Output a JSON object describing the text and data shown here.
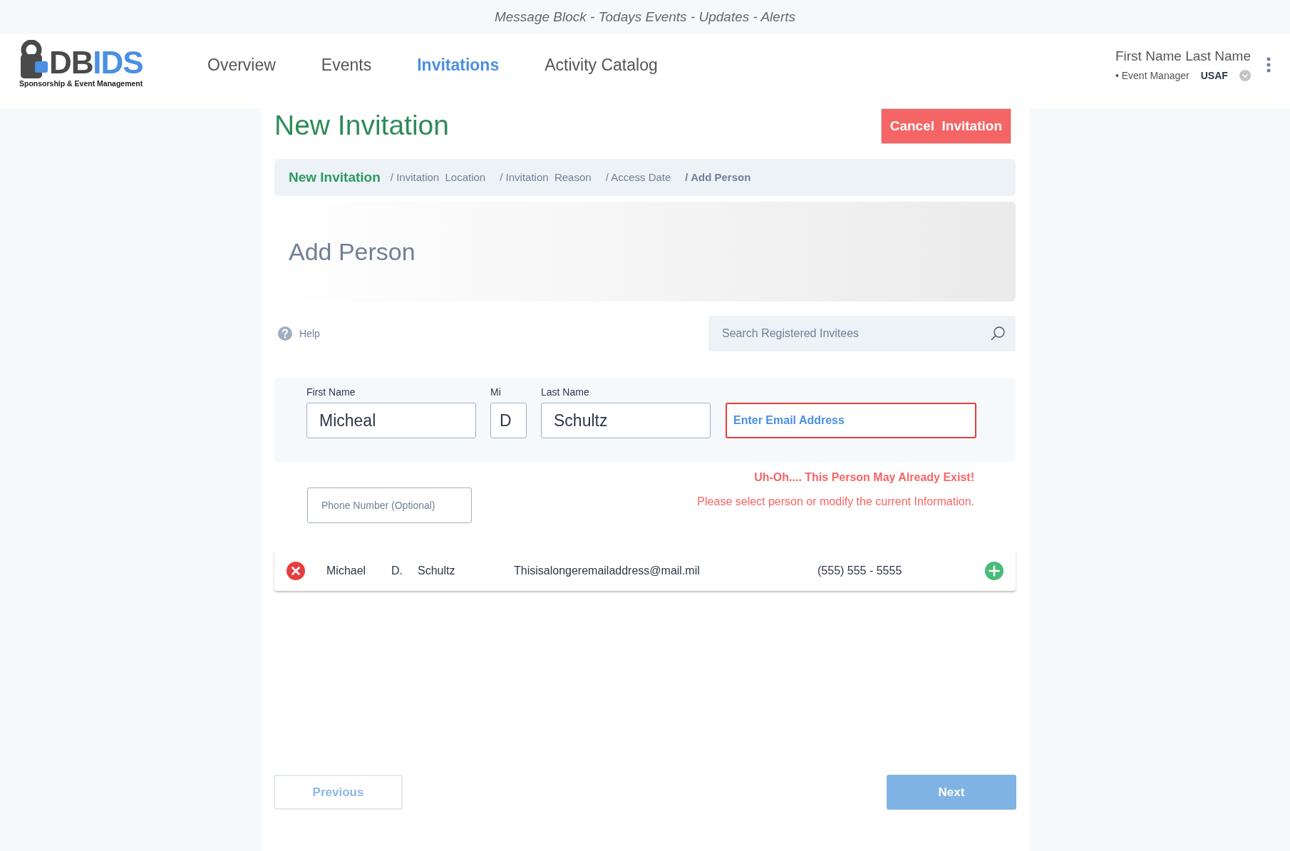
{
  "message_block": "Message Block - Todays Events - Updates - Alerts",
  "logo": {
    "wordmark_dark": "DB",
    "wordmark_blue": "IDS",
    "tagline": "Sponsorship & Event Management"
  },
  "nav": [
    {
      "label": "Overview",
      "selected": false
    },
    {
      "label": "Events",
      "selected": false
    },
    {
      "label": "Invitations",
      "selected": true
    },
    {
      "label": "Activity Catalog",
      "selected": false
    }
  ],
  "user": {
    "name": "First Name Last Name",
    "role": "• Event Manager",
    "branch": "USAF"
  },
  "page_title": "New Invitation",
  "cancel_button": "Cancel  Invitation",
  "breadcrumb": [
    {
      "label": "New Invitation",
      "kind": "start"
    },
    {
      "label": "/ Invitation  Location",
      "kind": "step"
    },
    {
      "label": "/ Invitation  Reason",
      "kind": "step"
    },
    {
      "label": "/ Access Date",
      "kind": "step"
    },
    {
      "label": "/ Add Person",
      "kind": "current"
    }
  ],
  "section_title": "Add Person",
  "help": "Help",
  "search": {
    "placeholder": "Search Registered Invitees"
  },
  "fields": [
    {
      "label": "First Name",
      "value": "Micheal",
      "invalid": false,
      "kind": "name"
    },
    {
      "label": "Mi",
      "value": "D",
      "invalid": false,
      "kind": "initial"
    },
    {
      "label": "Last Name",
      "value": "Schultz",
      "invalid": false,
      "kind": "name"
    },
    {
      "placeholder": "Enter Email Address",
      "invalid": true,
      "kind": "email"
    }
  ],
  "phone": {
    "placeholder": "Phone Number (Optional)"
  },
  "alert": {
    "title": "Uh-Oh.... This Person May Already Exist!",
    "message": "Please select person or modify the current Information."
  },
  "matches": [
    {
      "first": "Michael",
      "mi": "D.",
      "last": "Schultz",
      "email": "Thisisalongeremailaddress@mail.mil",
      "phone": "(555) 555 - 5555"
    }
  ],
  "footer": {
    "previous": {
      "label": "Previous",
      "disabled": true
    },
    "next": {
      "label": "Next",
      "disabled": true
    }
  }
}
